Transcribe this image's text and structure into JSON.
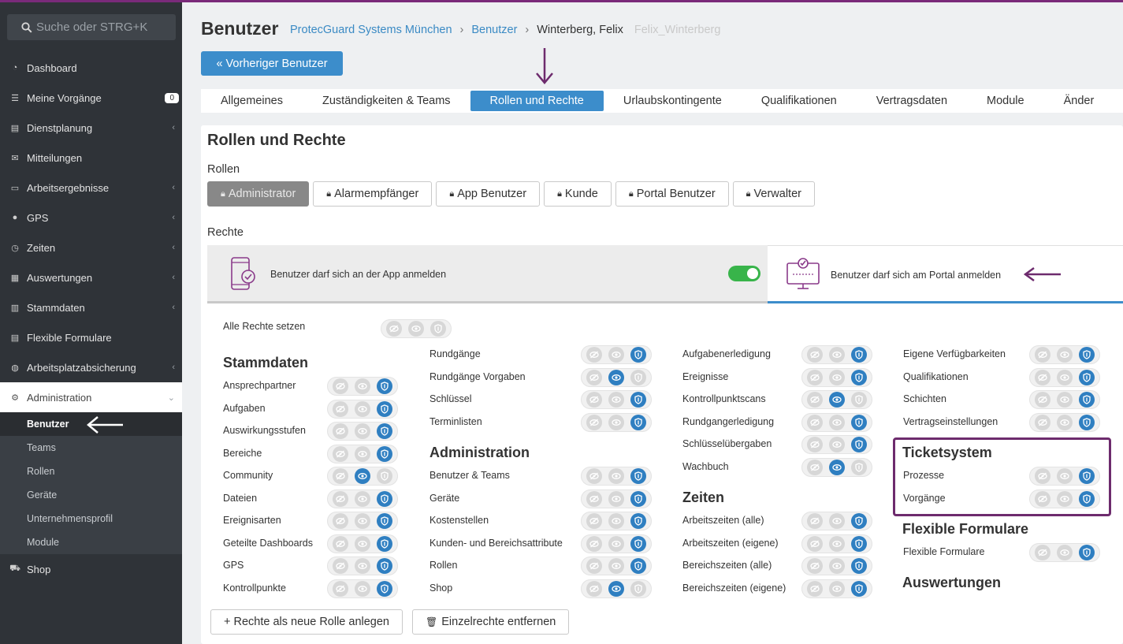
{
  "sidebar": {
    "search_placeholder": "Suche oder STRG+K",
    "items": [
      {
        "label": "Dashboard",
        "icon": "dashboard-icon"
      },
      {
        "label": "Meine Vorgänge",
        "icon": "list-icon",
        "badge": "0"
      },
      {
        "label": "Dienstplanung",
        "icon": "calendar-icon"
      },
      {
        "label": "Mitteilungen",
        "icon": "mail-icon"
      },
      {
        "label": "Arbeitsergebnisse",
        "icon": "monitor-icon"
      },
      {
        "label": "GPS",
        "icon": "pin-icon"
      },
      {
        "label": "Zeiten",
        "icon": "clock-icon"
      },
      {
        "label": "Auswertungen",
        "icon": "chart-icon"
      },
      {
        "label": "Stammdaten",
        "icon": "book-icon"
      },
      {
        "label": "Flexible Formulare",
        "icon": "form-icon"
      },
      {
        "label": "Arbeitsplatzabsicherung",
        "icon": "globe-icon"
      },
      {
        "label": "Administration",
        "icon": "gears-icon"
      }
    ],
    "sub_items": [
      "Benutzer",
      "Teams",
      "Rollen",
      "Geräte",
      "Unternehmensprofil",
      "Module"
    ],
    "shop": "Shop"
  },
  "header": {
    "title": "Benutzer",
    "crumb_company": "ProtecGuard Systems München",
    "crumb_users": "Benutzer",
    "crumb_name": "Winterberg, Felix",
    "crumb_username": "Felix_Winterberg",
    "prev_button": "« Vorheriger Benutzer"
  },
  "tabs": [
    "Allgemeines",
    "Zuständigkeiten & Teams",
    "Rollen und Rechte",
    "Urlaubskontingente",
    "Qualifikationen",
    "Vertragsdaten",
    "Module",
    "Änder"
  ],
  "panel": {
    "title": "Rollen und Rechte",
    "roles_label": "Rollen",
    "roles": [
      "Administrator",
      "Alarmempfänger",
      "App Benutzer",
      "Kunde",
      "Portal Benutzer",
      "Verwalter"
    ],
    "rights_label": "Rechte",
    "app_login": "Benutzer darf sich an der App anmelden",
    "portal_login": "Benutzer darf sich am Portal anmelden",
    "all_rights": "Alle Rechte setzen"
  },
  "col1": {
    "heading": "Stammdaten",
    "rows": [
      {
        "label": "Ansprechpartner",
        "state": "shield"
      },
      {
        "label": "Aufgaben",
        "state": "shield"
      },
      {
        "label": "Auswirkungsstufen",
        "state": "shield"
      },
      {
        "label": "Bereiche",
        "state": "shield"
      },
      {
        "label": "Community",
        "state": "eye"
      },
      {
        "label": "Dateien",
        "state": "shield"
      },
      {
        "label": "Ereignisarten",
        "state": "shield"
      },
      {
        "label": "Geteilte Dashboards",
        "state": "shield"
      },
      {
        "label": "GPS",
        "state": "shield"
      },
      {
        "label": "Kontrollpunkte",
        "state": "shield"
      }
    ]
  },
  "col2": {
    "rows_top": [
      {
        "label": "Rundgänge",
        "state": "shield"
      },
      {
        "label": "Rundgänge Vorgaben",
        "state": "eye"
      },
      {
        "label": "Schlüssel",
        "state": "shield"
      },
      {
        "label": "Terminlisten",
        "state": "shield"
      }
    ],
    "heading": "Administration",
    "rows": [
      {
        "label": "Benutzer & Teams",
        "state": "shield"
      },
      {
        "label": "Geräte",
        "state": "shield"
      },
      {
        "label": "Kostenstellen",
        "state": "shield"
      },
      {
        "label": "Kunden- und Bereichsattribute",
        "state": "shield"
      },
      {
        "label": "Rollen",
        "state": "shield"
      },
      {
        "label": "Shop",
        "state": "eye"
      }
    ]
  },
  "col3": {
    "rows_top": [
      {
        "label": "Aufgabenerledigung",
        "state": "shield"
      },
      {
        "label": "Ereignisse",
        "state": "shield"
      },
      {
        "label": "Kontrollpunktscans",
        "state": "eye"
      },
      {
        "label": "Rundgangerledigung",
        "state": "shield"
      },
      {
        "label": "Schlüsselübergaben",
        "state": "shield"
      },
      {
        "label": "Wachbuch",
        "state": "eye"
      }
    ],
    "heading": "Zeiten",
    "rows": [
      {
        "label": "Arbeitszeiten (alle)",
        "state": "shield"
      },
      {
        "label": "Arbeitszeiten (eigene)",
        "state": "shield"
      },
      {
        "label": "Bereichszeiten (alle)",
        "state": "shield"
      },
      {
        "label": "Bereichszeiten (eigene)",
        "state": "shield"
      }
    ]
  },
  "col4": {
    "rows_top": [
      {
        "label": "Eigene Verfügbarkeiten",
        "state": "shield"
      },
      {
        "label": "Qualifikationen",
        "state": "shield"
      },
      {
        "label": "Schichten",
        "state": "shield"
      },
      {
        "label": "Vertragseinstellungen",
        "state": "shield"
      }
    ],
    "ticket_heading": "Ticketsystem",
    "ticket_rows": [
      {
        "label": "Prozesse",
        "state": "shield"
      },
      {
        "label": "Vorgänge",
        "state": "shield"
      }
    ],
    "forms_heading": "Flexible Formulare",
    "forms_rows": [
      {
        "label": "Flexible Formulare",
        "state": "shield"
      }
    ],
    "eval_heading": "Auswertungen"
  },
  "buttons": {
    "new_role": "+ Rechte als neue Rolle anlegen",
    "remove": "Einzelrechte entfernen"
  },
  "colors": {
    "accent": "#3c8dcb",
    "sidebar": "#2f3338",
    "highlight": "#6d2b6d",
    "toggle_on": "#38b44a"
  }
}
